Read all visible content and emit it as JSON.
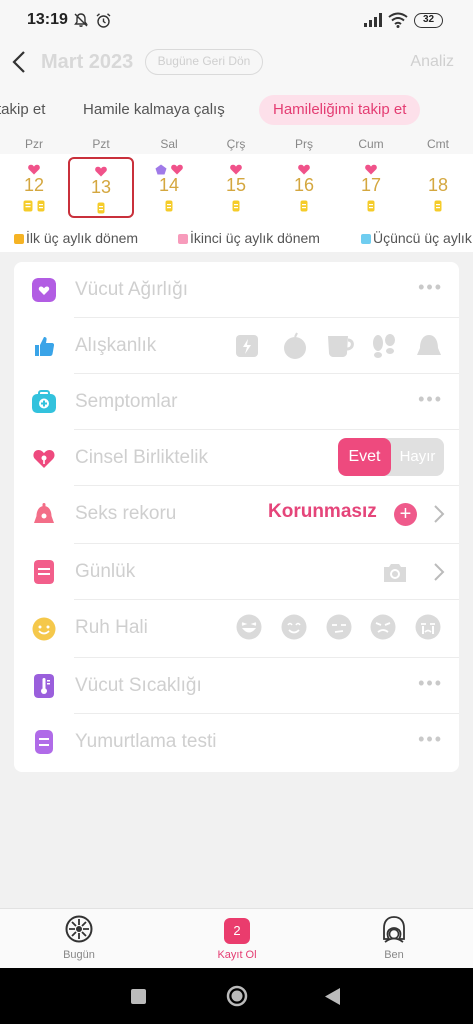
{
  "status_bar": {
    "time": "13:19",
    "battery": "32"
  },
  "header": {
    "month": "Mart 2023",
    "today_button": "Bugüne Geri Dön",
    "analysis": "Analiz"
  },
  "mode_tabs": [
    {
      "label": "takip et"
    },
    {
      "label": "Hamile kalmaya çalış"
    },
    {
      "label": "Hamileliğimi takip et",
      "active": true
    }
  ],
  "weekdays": [
    "Pzr",
    "Pzt",
    "Sal",
    "Çrş",
    "Prş",
    "Cum",
    "Cmt"
  ],
  "days": [
    {
      "num": "12",
      "marks": [
        "heart"
      ],
      "icons": [
        "yellow",
        "yellow"
      ]
    },
    {
      "num": "13",
      "marks": [
        "heart"
      ],
      "icons": [
        "yellow"
      ],
      "selected": true
    },
    {
      "num": "14",
      "marks": [
        "pentagon",
        "heart"
      ],
      "icons": [
        "yellow"
      ]
    },
    {
      "num": "15",
      "marks": [
        "heart"
      ],
      "icons": [
        "yellow"
      ]
    },
    {
      "num": "16",
      "marks": [
        "heart"
      ],
      "icons": [
        "yellow"
      ]
    },
    {
      "num": "17",
      "marks": [
        "heart"
      ],
      "icons": [
        "yellow"
      ]
    },
    {
      "num": "18",
      "marks": [],
      "icons": [
        "yellow"
      ]
    }
  ],
  "legend": [
    {
      "label": "İlk üç aylık dönem",
      "color": "#f5b324"
    },
    {
      "label": "İkinci üç aylık dönem",
      "color": "#f79bbb"
    },
    {
      "label": "Üçüncü üç aylık",
      "color": "#6fcdf0"
    }
  ],
  "rows": {
    "weight": {
      "label": "Vücut Ağırlığı",
      "icon": "scale-icon",
      "color": "#b25de3",
      "action": "more-icon"
    },
    "habit": {
      "label": "Alışkanlık",
      "icon": "thumbs-up-icon",
      "color": "#3aa4e8",
      "habit_icons": [
        "coffee-cup-icon",
        "apple-icon",
        "cup-icon",
        "footprints-icon",
        "bell-icon"
      ]
    },
    "symptoms": {
      "label": "Semptomlar",
      "icon": "medical-kit-icon",
      "color": "#33c2dd",
      "action": "more-icon"
    },
    "intimacy": {
      "label": "Cinsel Birliktelik",
      "icon": "heart-icon",
      "color": "#ee4a7e",
      "yes": "Evet",
      "no": "Hayır"
    },
    "sex_record": {
      "label": "Seks rekoru",
      "icon": "bell-icon",
      "color": "#f36e88",
      "value": "Korunmasız"
    },
    "diary": {
      "label": "Günlük",
      "icon": "notebook-icon",
      "color": "#f25f8b",
      "action": "camera-icon"
    },
    "mood": {
      "label": "Ruh Hali",
      "icon": "smile-icon",
      "color": "#f5c84b",
      "moods": [
        "laugh-icon",
        "happy-icon",
        "annoyed-icon",
        "angry-icon",
        "cry-icon"
      ]
    },
    "temperature": {
      "label": "Vücut Sıcaklığı",
      "icon": "thermometer-icon",
      "color": "#9a5fdc",
      "action": "more-icon"
    },
    "ovulation": {
      "label": "Yumurtlama testi",
      "icon": "test-strip-icon",
      "color": "#b06be8",
      "action": "more-icon"
    }
  },
  "bottom_nav": [
    {
      "label": "Bugün",
      "icon": "today-icon"
    },
    {
      "label": "Kayıt Ol",
      "icon": "calendar-badge-icon",
      "badge": "2",
      "active": true
    },
    {
      "label": "Ben",
      "icon": "profile-icon"
    }
  ],
  "colors": {
    "accent": "#e43d73",
    "day_number": "#d4a73f",
    "selected_border": "#c9303b"
  }
}
